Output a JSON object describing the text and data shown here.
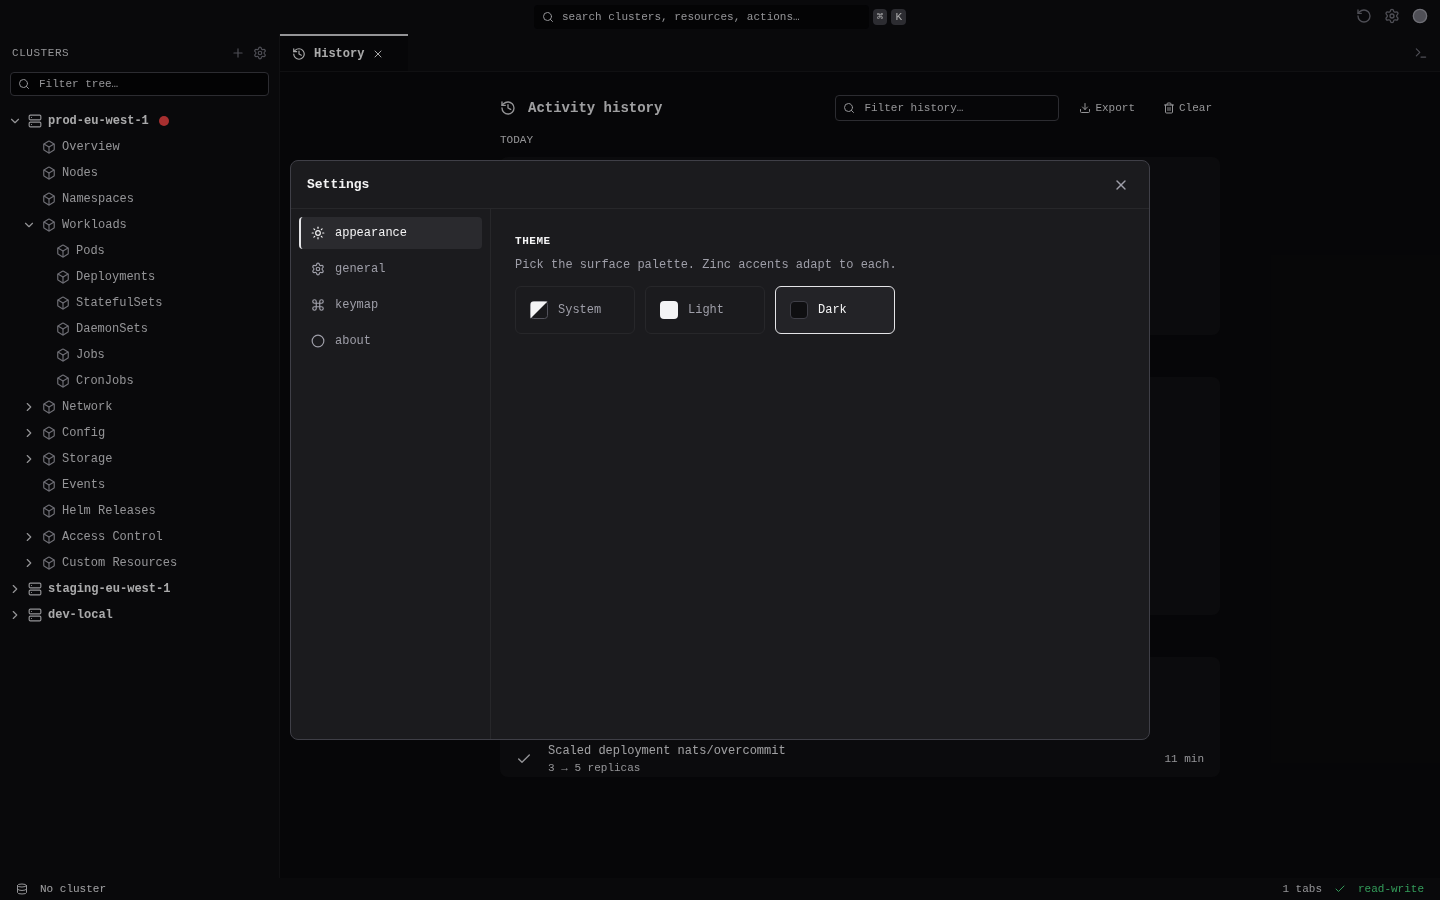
{
  "top_bar": {
    "search_placeholder": "search clusters, resources, actions…",
    "keys": [
      "⌘",
      "K"
    ]
  },
  "sidebar": {
    "title": "CLUSTERS",
    "filter_placeholder": "Filter tree…",
    "tree": [
      {
        "label": "prod-eu-west-1",
        "kind": "cluster",
        "expanded": true,
        "alert": true,
        "children": [
          {
            "label": "Overview",
            "kind": "leaf"
          },
          {
            "label": "Nodes",
            "kind": "leaf"
          },
          {
            "label": "Namespaces",
            "kind": "leaf"
          },
          {
            "label": "Workloads",
            "kind": "group",
            "expanded": true,
            "children": [
              {
                "label": "Pods",
                "kind": "leaf"
              },
              {
                "label": "Deployments",
                "kind": "leaf"
              },
              {
                "label": "StatefulSets",
                "kind": "leaf"
              },
              {
                "label": "DaemonSets",
                "kind": "leaf"
              },
              {
                "label": "Jobs",
                "kind": "leaf"
              },
              {
                "label": "CronJobs",
                "kind": "leaf"
              }
            ]
          },
          {
            "label": "Network",
            "kind": "group",
            "expanded": false
          },
          {
            "label": "Config",
            "kind": "group",
            "expanded": false
          },
          {
            "label": "Storage",
            "kind": "group",
            "expanded": false
          },
          {
            "label": "Events",
            "kind": "leaf"
          },
          {
            "label": "Helm Releases",
            "kind": "leaf"
          },
          {
            "label": "Access Control",
            "kind": "group",
            "expanded": false
          },
          {
            "label": "Custom Resources",
            "kind": "group",
            "expanded": false
          }
        ]
      },
      {
        "label": "staging-eu-west-1",
        "kind": "cluster",
        "expanded": false,
        "alert": false
      },
      {
        "label": "dev-local",
        "kind": "cluster",
        "expanded": false,
        "alert": false
      }
    ]
  },
  "tabs": [
    {
      "label": "History",
      "selected": true
    }
  ],
  "history": {
    "title": "Activity history",
    "filter_placeholder": "Filter history…",
    "actions": [
      "Export",
      "Clear"
    ],
    "group_label": "TODAY",
    "last_row": {
      "title": "Scaled deployment nats/overcommit",
      "detail": "3 → 5 replicas",
      "time": "11 min"
    }
  },
  "status_bar": {
    "cluster": "No cluster",
    "tabs": "1 tabs",
    "mode": "read-write"
  },
  "settings": {
    "title": "Settings",
    "nav": [
      {
        "label": "appearance",
        "selected": true
      },
      {
        "label": "general",
        "selected": false
      },
      {
        "label": "keymap",
        "selected": false
      },
      {
        "label": "about",
        "selected": false
      }
    ],
    "section_title": "THEME",
    "description": "Pick the surface palette. Zinc accents adapt to each.",
    "themes": [
      {
        "label": "System",
        "kind": "system",
        "selected": false
      },
      {
        "label": "Light",
        "kind": "light",
        "selected": false
      },
      {
        "label": "Dark",
        "kind": "dark",
        "selected": true
      }
    ]
  }
}
